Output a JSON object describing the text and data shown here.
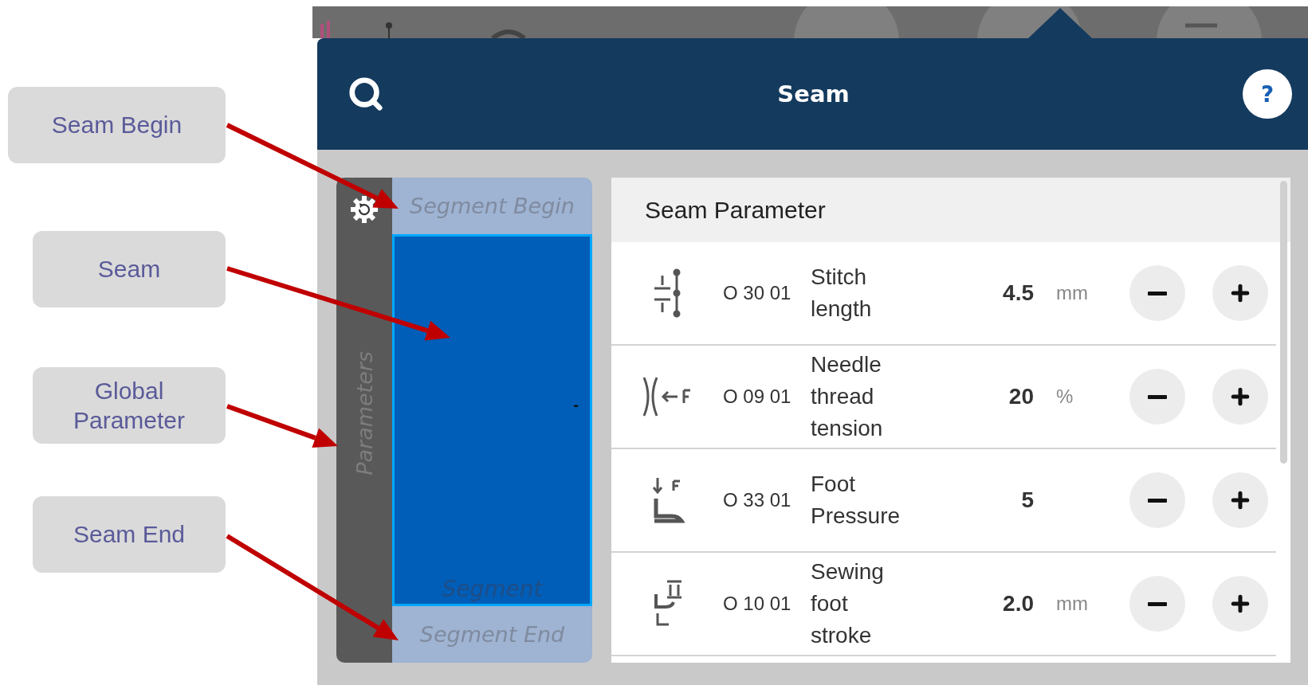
{
  "callouts": [
    {
      "label": "Seam Begin"
    },
    {
      "label": "Seam"
    },
    {
      "label": "Global Parameter"
    },
    {
      "label": "Seam End"
    }
  ],
  "dialog": {
    "title": "Seam",
    "help": "?"
  },
  "sidebar": {
    "label": "Parameters"
  },
  "segments": {
    "begin": "Segment Begin",
    "middle": "Segment",
    "end": "Segment End",
    "selected": true,
    "marker": "-"
  },
  "panel": {
    "title": "Seam Parameter",
    "rows": [
      {
        "kind": "stitch",
        "code": "O 30 01",
        "name": "Stitch length",
        "value": "4.5",
        "unit": "mm"
      },
      {
        "kind": "tension",
        "code": "O 09 01",
        "name": "Needle thread tension",
        "value": "20",
        "unit": "%"
      },
      {
        "kind": "pressure",
        "code": "O 33 01",
        "name": "Foot Pressure",
        "value": "5"
      },
      {
        "kind": "stroke",
        "code": "O 10 01",
        "name": "Sewing foot stroke",
        "value": "2.0",
        "unit": "mm"
      }
    ]
  }
}
